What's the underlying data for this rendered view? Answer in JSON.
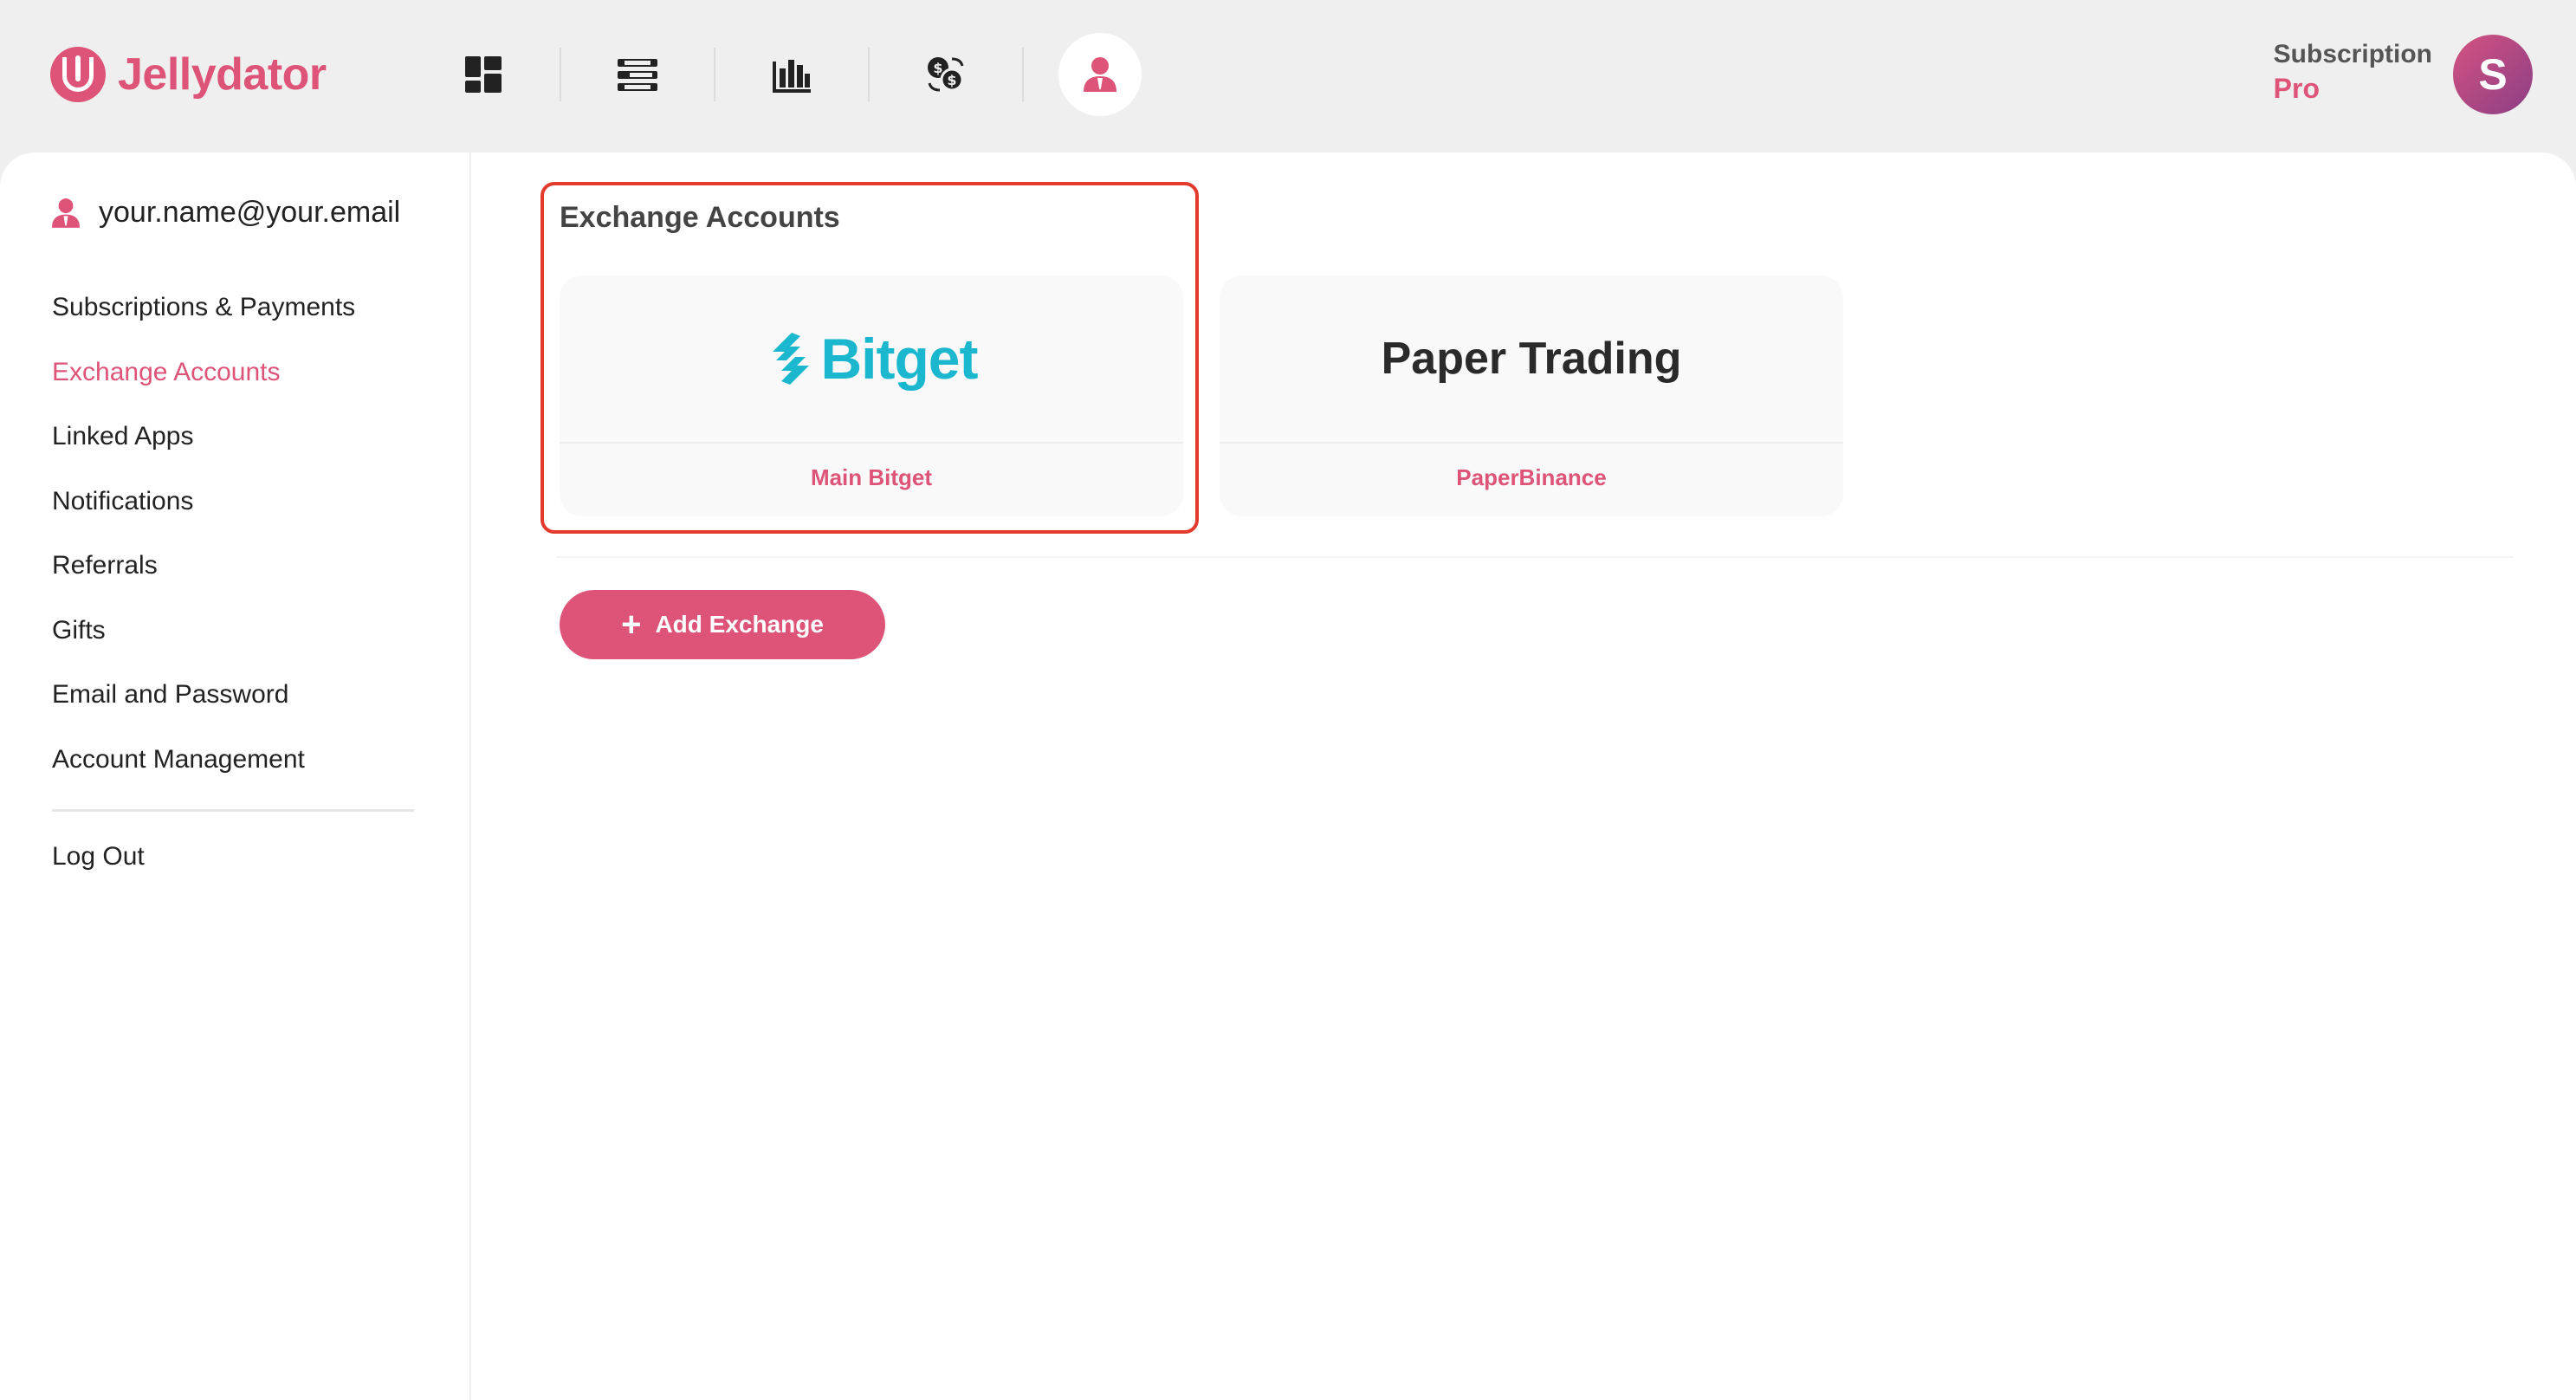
{
  "brand": {
    "name": "Jellydator",
    "color": "#dd5478"
  },
  "nav": {
    "items": [
      {
        "name": "dashboard",
        "icon": "dashboard-grid-icon"
      },
      {
        "name": "bots",
        "icon": "list-sort-icon"
      },
      {
        "name": "statistics",
        "icon": "bar-chart-icon"
      },
      {
        "name": "exchange",
        "icon": "currency-exchange-icon"
      },
      {
        "name": "account",
        "icon": "user-icon",
        "active": true
      }
    ]
  },
  "subscription": {
    "label": "Subscription",
    "plan": "Pro"
  },
  "avatar": {
    "initial": "S"
  },
  "sidebar": {
    "email": "your.name@your.email",
    "items": [
      {
        "label": "Subscriptions & Payments"
      },
      {
        "label": "Exchange Accounts",
        "active": true
      },
      {
        "label": "Linked Apps"
      },
      {
        "label": "Notifications"
      },
      {
        "label": "Referrals"
      },
      {
        "label": "Gifts"
      },
      {
        "label": "Email and Password"
      },
      {
        "label": "Account Management"
      }
    ],
    "logout": "Log Out"
  },
  "main": {
    "title": "Exchange Accounts",
    "cards": [
      {
        "logo_text": "Bitget",
        "label": "Main Bitget",
        "logo_color": "#1bb7cf"
      },
      {
        "logo_text": "Paper Trading",
        "label": "PaperBinance"
      }
    ],
    "add_button": "Add Exchange"
  }
}
